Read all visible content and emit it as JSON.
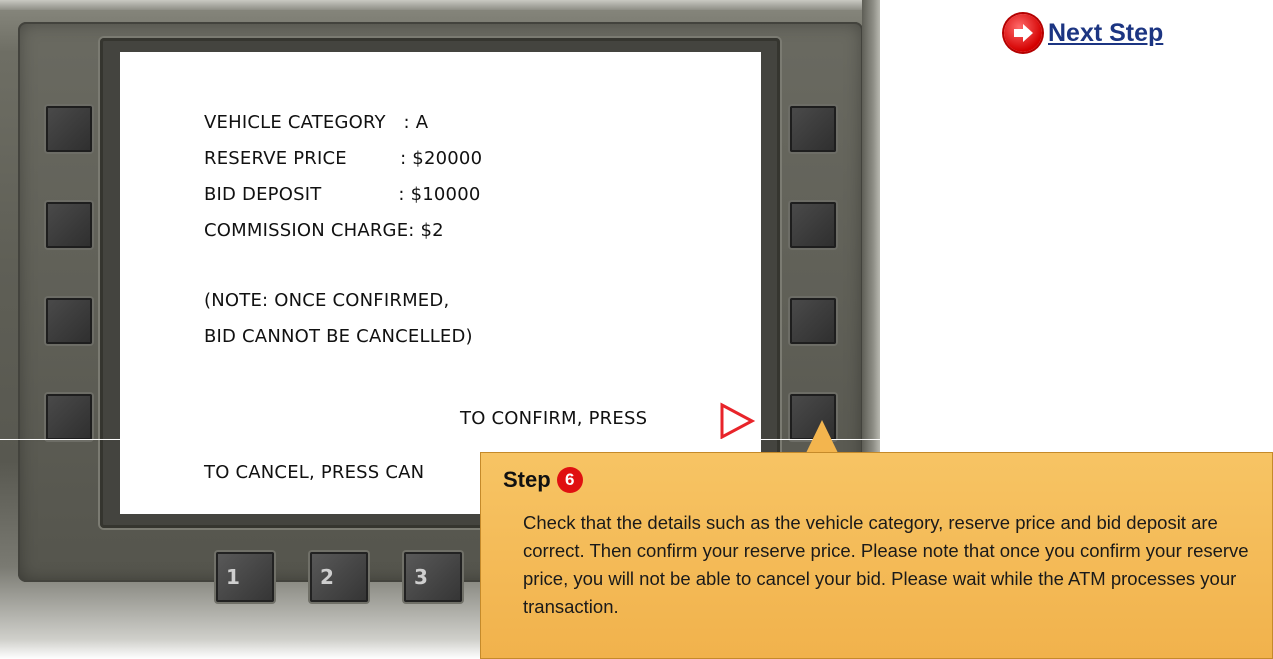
{
  "navigation": {
    "next_step_label": "Next Step"
  },
  "atm_screen": {
    "lines": {
      "vehicle_category": "VEHICLE CATEGORY   : A",
      "reserve_price": "RESERVE PRICE         : $20000",
      "bid_deposit": "BID DEPOSIT             : $10000",
      "commission_charge": "COMMISSION CHARGE: $2",
      "note_line1": "(NOTE: ONCE CONFIRMED,",
      "note_line2": "BID CANNOT BE CANCELLED)",
      "confirm_prompt": "TO CONFIRM, PRESS",
      "cancel_prompt": "TO CANCEL, PRESS CAN"
    }
  },
  "keypad": {
    "keys": [
      "1",
      "2",
      "3"
    ]
  },
  "step_callout": {
    "label": "Step",
    "number": "6",
    "text": "Check that the details such as the vehicle category, reserve price and bid deposit are correct. Then confirm your reserve price. Please note that once you confirm your reserve price, you will not be able to cancel your bid. Please wait while the ATM processes your transaction."
  },
  "colors": {
    "callout_bg": "#f3b54e",
    "accent_red": "#e01010",
    "link_blue": "#1c3582"
  }
}
